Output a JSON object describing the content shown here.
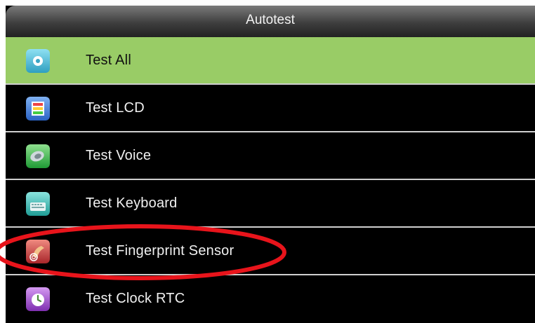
{
  "header": {
    "title": "Autotest"
  },
  "menu": {
    "selected_index": 0,
    "items": [
      {
        "label": "Test All",
        "icon": "circle-icon",
        "color": "#4fb7d3"
      },
      {
        "label": "Test LCD",
        "icon": "lcd-icon",
        "color": "#3b7bd6"
      },
      {
        "label": "Test Voice",
        "icon": "speaker-icon",
        "color": "#3cb84a"
      },
      {
        "label": "Test Keyboard",
        "icon": "keyboard-icon",
        "color": "#2fb7b0"
      },
      {
        "label": "Test Fingerprint Sensor",
        "icon": "fingerprint-icon",
        "color": "#c9403a"
      },
      {
        "label": "Test Clock RTC",
        "icon": "clock-icon",
        "color": "#a04fc4"
      }
    ]
  },
  "annotation": {
    "color": "#e8141b",
    "target": "Test Fingerprint Sensor"
  },
  "colors": {
    "selected_row": "#99cc66",
    "background": "#000000",
    "separator": "#cfcfcf"
  }
}
